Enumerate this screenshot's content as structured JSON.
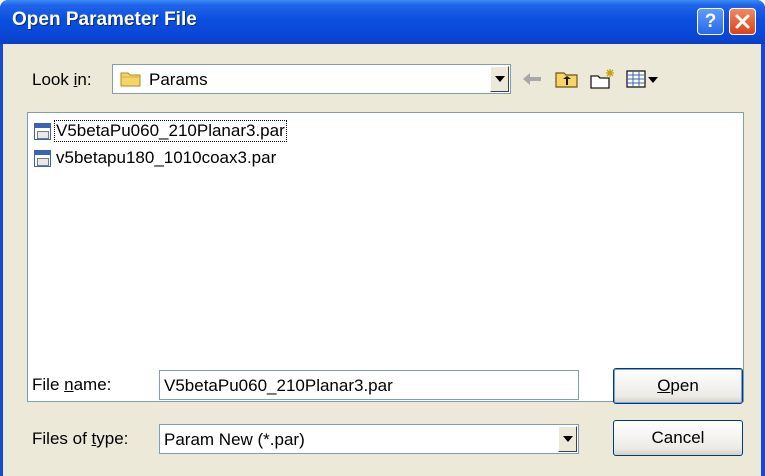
{
  "window": {
    "title": "Open Parameter File"
  },
  "titlebar_buttons": {
    "help": "?",
    "close": "✕"
  },
  "look_in": {
    "label_pre": "Look ",
    "label_accel": "i",
    "label_post": "n:",
    "value": "Params"
  },
  "files": [
    {
      "name": "V5betaPu060_210Planar3.par",
      "icon": "param-file-icon",
      "focused": true
    },
    {
      "name": "v5betapu180_1010coax3.par",
      "icon": "param-file-icon",
      "focused": false
    }
  ],
  "file_name": {
    "label_pre": "File ",
    "label_accel": "n",
    "label_post": "ame:",
    "value": "V5betaPu060_210Planar3.par"
  },
  "file_type": {
    "label_pre": "Files of ",
    "label_accel": "t",
    "label_post": "ype:",
    "value": "Param New (*.par)"
  },
  "buttons": {
    "open_accel": "O",
    "open_rest": "pen",
    "cancel": "Cancel"
  },
  "colors": {
    "titlebar": "#0a47d6",
    "dialog_bg": "#ece9d8",
    "border": "#7f9db9"
  }
}
